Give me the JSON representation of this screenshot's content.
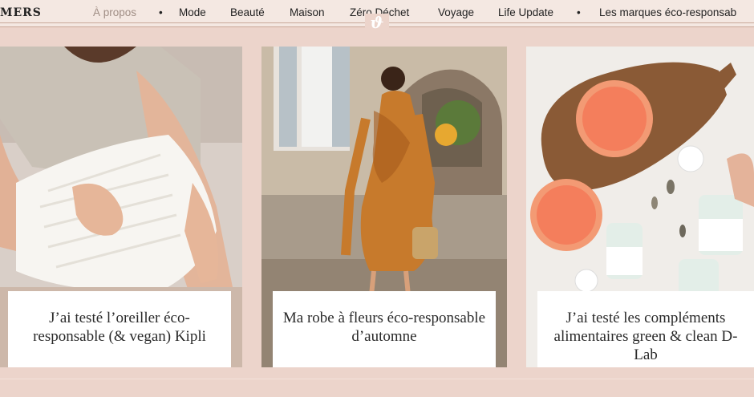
{
  "header": {
    "logo_text": "MERS",
    "nav_items": [
      {
        "label": "À propos"
      },
      {
        "label": "•"
      },
      {
        "label": "Mode"
      },
      {
        "label": "Beauté"
      },
      {
        "label": "Maison"
      },
      {
        "label": "Zéro Déchet"
      },
      {
        "label": "Voyage"
      },
      {
        "label": "Life Update"
      },
      {
        "label": "•"
      },
      {
        "label": "Les marques éco-responsab"
      }
    ]
  },
  "cards": [
    {
      "title": "J’ai testé l’oreiller éco-responsable (& vegan) Kipli",
      "image": "woman-with-pillow-photo"
    },
    {
      "title": "Ma robe à fleurs éco-responsable d’automne",
      "image": "woman-floral-dress-photo"
    },
    {
      "title": "J’ai testé les compléments alimentaires green & clean D-Lab",
      "image": "grapefruit-supplements-photo"
    }
  ],
  "colors": {
    "background": "#ecd4cb",
    "nav_bg": "#f4e8e2",
    "caption_bg": "#ffffff",
    "text": "#2a2a2a",
    "muted": "#a08e85"
  }
}
